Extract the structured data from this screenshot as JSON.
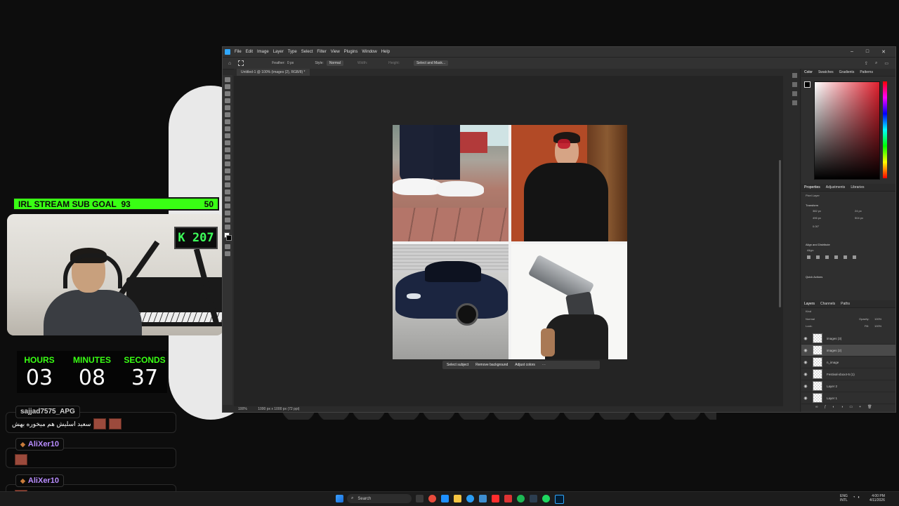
{
  "overlay": {
    "sub_goal_label": "IRL STREAM SUB GOAL",
    "sub_goal_current": "93",
    "sub_goal_target": "50",
    "counter_display": "K 207",
    "timer": [
      {
        "label": "HOURS",
        "value": "03"
      },
      {
        "label": "MINUTES",
        "value": "08"
      },
      {
        "label": "SECONDS",
        "value": "37"
      }
    ],
    "chat": [
      {
        "user": "sajjad7575_APG",
        "message": "سعید اسلیش هم میخوره بهش"
      },
      {
        "user": "AliXer10",
        "message": ""
      },
      {
        "user": "AliXer10",
        "message": ""
      }
    ]
  },
  "photoshop": {
    "menu": [
      "File",
      "Edit",
      "Image",
      "Layer",
      "Type",
      "Select",
      "Filter",
      "View",
      "Plugins",
      "Window",
      "Help"
    ],
    "options": {
      "feather": "Feather:",
      "feather_value": "0 px",
      "style_label": "Style:",
      "style_value": "Normal",
      "width_label": "Width:",
      "height_label": "Height:",
      "select_mask": "Select and Mask..."
    },
    "doc_tab": "Untitled-1 @ 100% (images (2), RGB/8) *",
    "status_zoom": "100%",
    "status_info": "1000 px x 1000 px (72 ppi)",
    "context_bar": [
      "Select subject",
      "Remove background",
      "Adjust colors"
    ],
    "color_panel_tabs": [
      "Color",
      "Swatches",
      "Gradients",
      "Patterns"
    ],
    "properties_tabs": [
      "Properties",
      "Adjustments",
      "Libraries"
    ],
    "properties": {
      "layer_type": "Pixel Layer",
      "transform_label": "Transform",
      "w": "382 px",
      "h": "496 px",
      "x": "24 px",
      "y": "504 px",
      "angle": "0.00°",
      "align_label": "Align and Distribute",
      "align_sub": "Align:",
      "quick_actions": "Quick Actions"
    },
    "layers_tabs": [
      "Layers",
      "Channels",
      "Paths"
    ],
    "layers_kind": "Kind",
    "blend_mode": "Normal",
    "opacity_label": "Opacity:",
    "opacity_value": "100%",
    "lock_label": "Lock:",
    "fill_label": "Fill:",
    "fill_value": "100%",
    "layers": [
      {
        "name": "images (3)",
        "selected": false
      },
      {
        "name": "images (2)",
        "selected": true
      },
      {
        "name": "n_image",
        "selected": false
      },
      {
        "name": "Festival-xbox4-5 (1)",
        "selected": false
      },
      {
        "name": "Layer 2",
        "selected": false
      },
      {
        "name": "Layer 1",
        "selected": false
      }
    ]
  },
  "taskbar": {
    "search_placeholder": "Search",
    "lang": "ENG",
    "lang2": "INTL",
    "time": "4:00 PM",
    "date": "4/11/2026"
  }
}
